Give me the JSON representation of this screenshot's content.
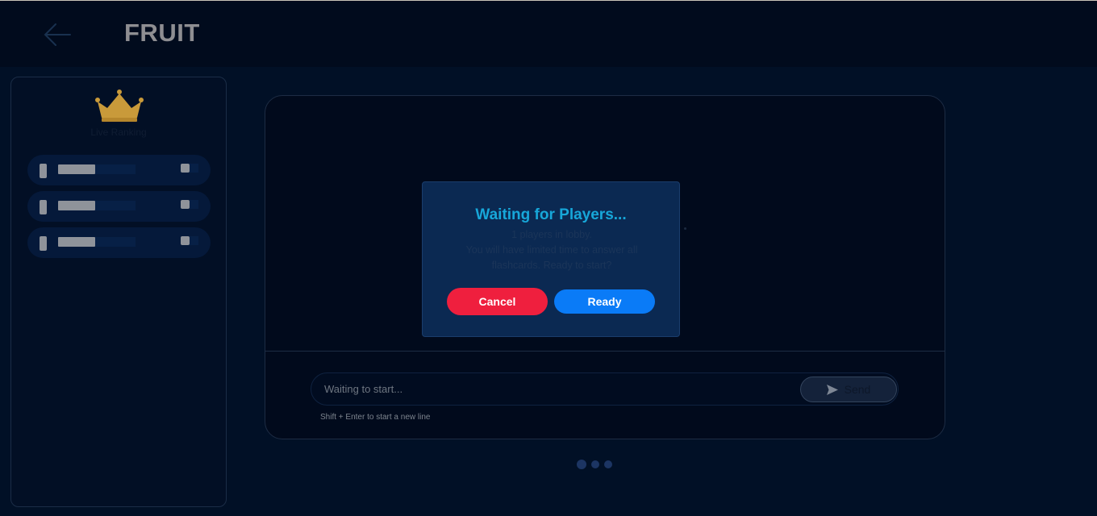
{
  "header": {
    "title": "FRUIT",
    "back_icon": "arrow-left-icon"
  },
  "sidebar": {
    "crown_icon": "crown-icon",
    "ranking_label": "Live Ranking",
    "rows_count_visible": 3
  },
  "chat": {
    "placeholder": "Waiting to start...",
    "send_label": "Send",
    "send_icon": "send-icon",
    "hint": "Shift + Enter to start a new line"
  },
  "modal": {
    "title": "Waiting for Players...",
    "lines": [
      "1 players in lobby.",
      "You will have limited time to answer all",
      "flashcards. Ready to start?"
    ],
    "cancel_label": "Cancel",
    "ready_label": "Ready"
  },
  "colors": {
    "accent": "#17a7d9",
    "cancel": "#ef1f3e",
    "ready": "#0a7bf7",
    "crown": "#c99a3a"
  }
}
